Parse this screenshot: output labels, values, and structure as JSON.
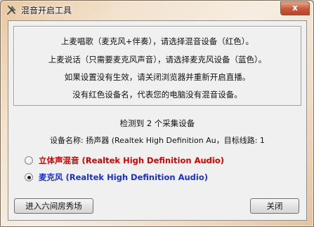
{
  "window": {
    "title": "混音开启工具",
    "close_glyph": "x"
  },
  "info": {
    "lines": [
      "上麦唱歌（麦克风+伴奏），请选择混音设备（红色）。",
      "上麦说话（只需要麦克风声音），请选择麦克风设备（蓝色）。",
      "如果设置没有生效，请关闭浏览器并重新开启直播。",
      "没有红色设备名，代表您的电脑没有混音设备。"
    ]
  },
  "detection": {
    "summary": "检测到 2 个采集设备",
    "device_info": "设备名称: 扬声器 (Realtek High Definition Au，目标线路: 1"
  },
  "devices": [
    {
      "label": "立体声混音 (Realtek High Definition Audio)",
      "color": "#d40000",
      "selected": false
    },
    {
      "label": "麦克风 (Realtek High Definition Audio)",
      "color": "#1a2fcf",
      "selected": true
    }
  ],
  "buttons": {
    "enter_room": "进入六间房秀场",
    "close": "关闭"
  }
}
